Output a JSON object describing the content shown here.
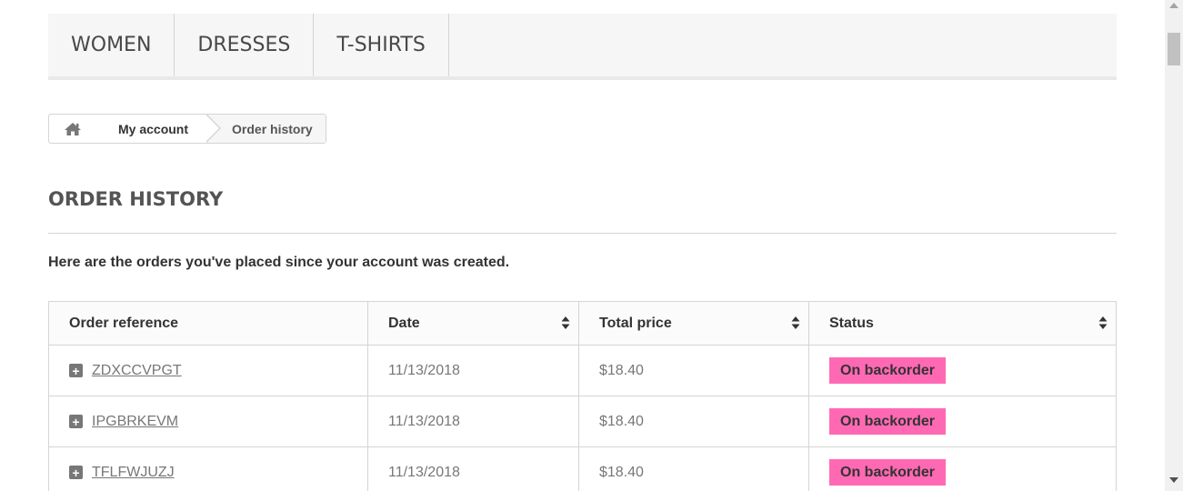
{
  "menu": {
    "items": [
      {
        "label": "WOMEN"
      },
      {
        "label": "DRESSES"
      },
      {
        "label": "T-SHIRTS"
      }
    ]
  },
  "breadcrumb": {
    "home_icon": "home-icon",
    "account": "My account",
    "current": "Order history"
  },
  "page": {
    "title": "ORDER HISTORY",
    "intro": "Here are the orders you've placed since your account was created."
  },
  "table": {
    "headers": [
      "Order reference",
      "Date",
      "Total price",
      "Status"
    ],
    "rows": [
      {
        "reference": "ZDXCCVPGT",
        "date": "11/13/2018",
        "total": "$18.40",
        "status": "On backorder"
      },
      {
        "reference": "IPGBRKEVM",
        "date": "11/13/2018",
        "total": "$18.40",
        "status": "On backorder"
      },
      {
        "reference": "TFLFWJUZJ",
        "date": "11/13/2018",
        "total": "$18.40",
        "status": "On backorder"
      }
    ]
  },
  "colors": {
    "status_badge": "#ff69b4",
    "menu_background": "#f6f6f6"
  }
}
